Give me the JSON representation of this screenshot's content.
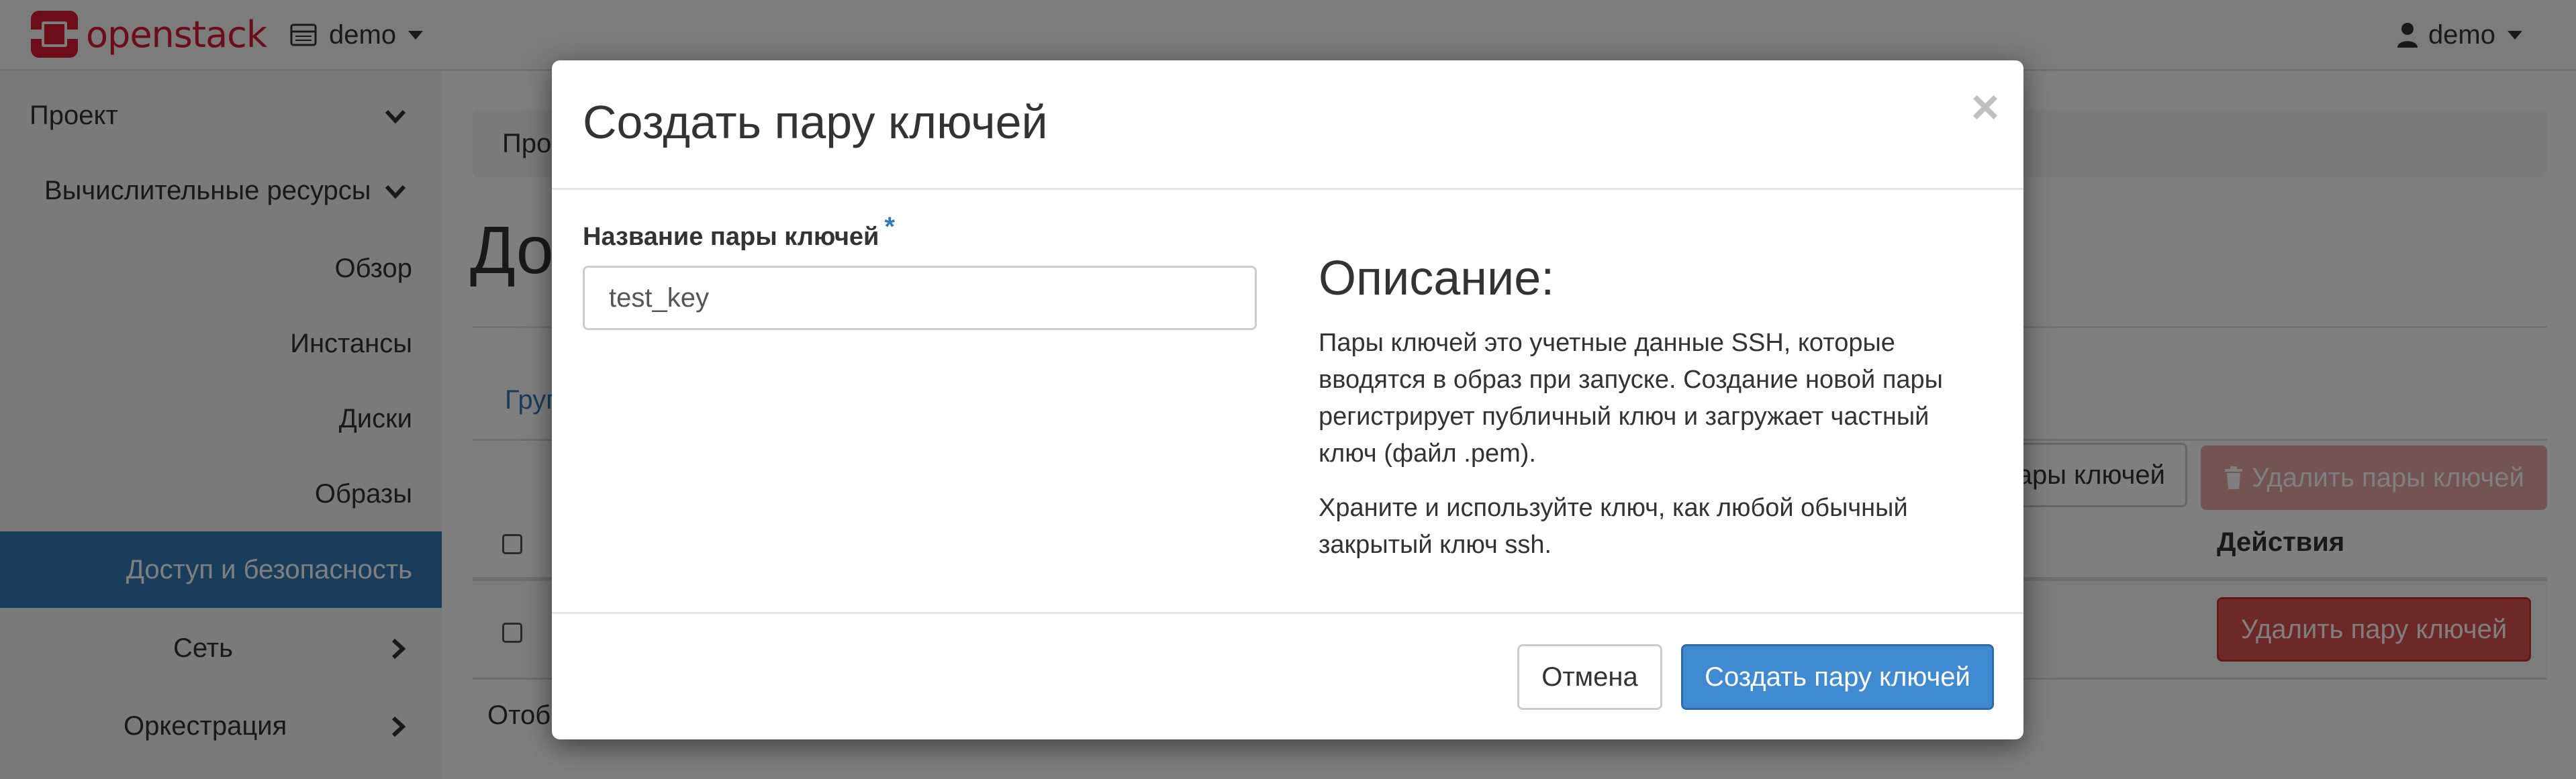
{
  "navbar": {
    "logo_text": "openstack",
    "project": "demo",
    "user": "demo",
    "icons": {
      "logo": "openstack-logo-icon",
      "project": "server-icon",
      "user": "user-icon"
    }
  },
  "sidebar": {
    "items": [
      {
        "label": "Проект",
        "icon": "chevron-down-icon"
      },
      {
        "label": "Вычислительные ресурсы",
        "icon": "chevron-down-icon"
      },
      {
        "label": "Обзор"
      },
      {
        "label": "Инстансы"
      },
      {
        "label": "Диски"
      },
      {
        "label": "Образы"
      },
      {
        "label": "Доступ и безопасность",
        "active": true
      },
      {
        "label": "Сеть",
        "icon": "chevron-right-icon"
      },
      {
        "label": "Оркестрация",
        "icon": "chevron-right-icon"
      }
    ]
  },
  "page": {
    "breadcrumb": "Про",
    "title": "До",
    "tab_visible": "Груп",
    "import_button": "ары ключей",
    "delete_selected_button": "Удалить пары ключей",
    "actions_header": "Действия",
    "row_delete_button": "Удалить пару ключей",
    "footer": "Отоб"
  },
  "modal": {
    "title": "Создать пару ключей",
    "close": "×",
    "field_label": "Название пары ключей",
    "required_mark": "*",
    "input_value": "test_key",
    "description_title": "Описание:",
    "description_p1": "Пары ключей это учетные данные SSH, которые вводятся в образ при запуске. Создание новой пары регистрирует публичный ключ и загружает частный ключ (файл .pem).",
    "description_p2": "Храните и используйте ключ, как любой обычный закрытый ключ ssh.",
    "cancel_button": "Отмена",
    "submit_button": "Создать пару ключей"
  },
  "colors": {
    "primary": "#337ab7",
    "danger": "#d9534f",
    "brand": "#da1a32"
  }
}
